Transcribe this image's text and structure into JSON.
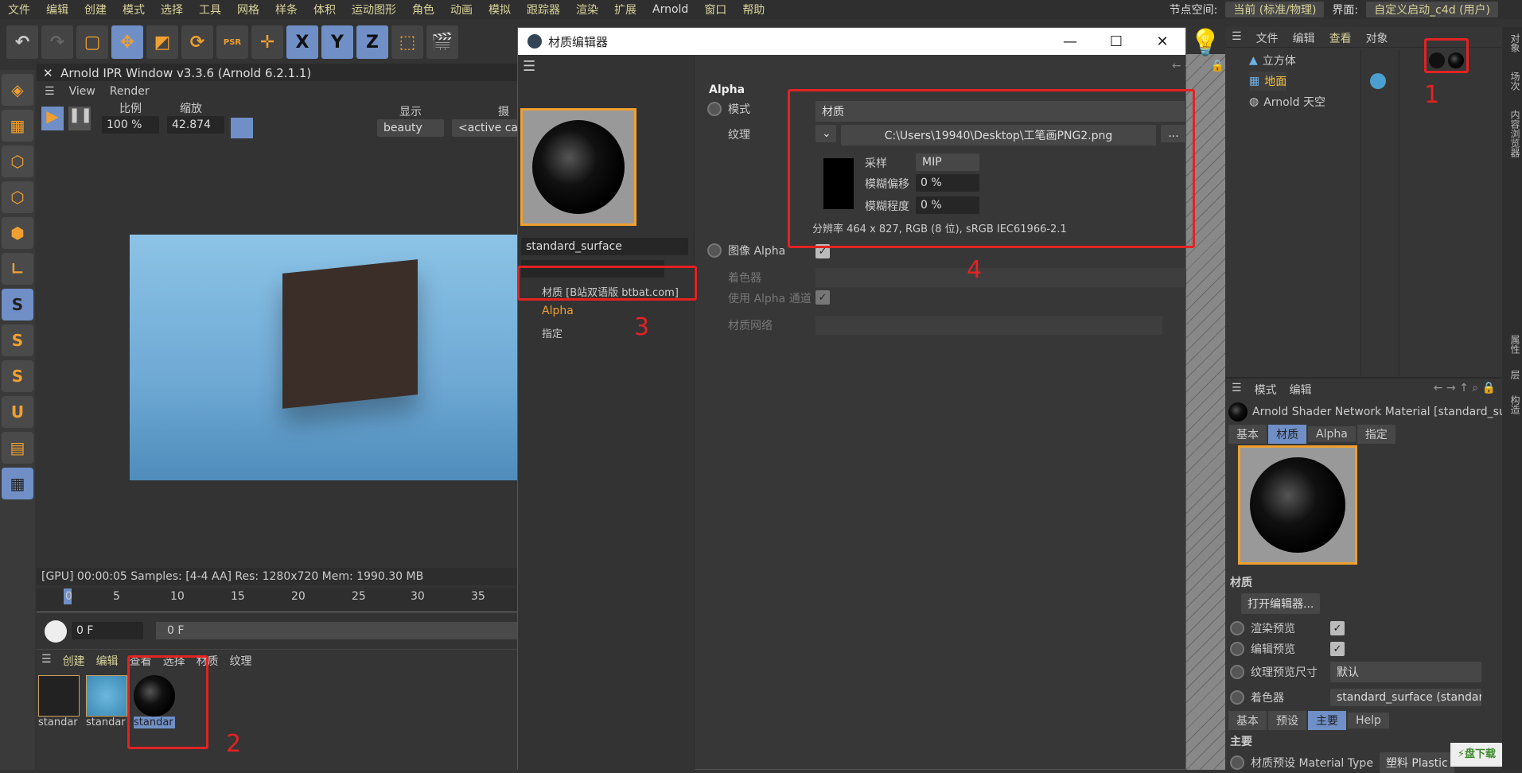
{
  "menu": [
    "文件",
    "编辑",
    "创建",
    "模式",
    "选择",
    "工具",
    "网格",
    "样条",
    "体积",
    "运动图形",
    "角色",
    "动画",
    "模拟",
    "跟踪器",
    "渲染",
    "扩展",
    "Arnold",
    "窗口",
    "帮助"
  ],
  "node_space": {
    "label": "节点空间:",
    "value": "当前 (标准/物理)"
  },
  "layout": {
    "label": "界面:",
    "value": "自定义启动_c4d (用户)"
  },
  "toolbar": {
    "x": "X",
    "y": "Y",
    "z": "Z",
    "psr": "PSR"
  },
  "ipr": {
    "title": "Arnold IPR Window v3.3.6 (Arnold 6.2.1.1)",
    "menu": [
      "View",
      "Render"
    ],
    "ratio_label": "比例",
    "ratio": "100 %",
    "zoom_label": "缩放",
    "zoom": "42.874",
    "display_label": "显示",
    "display": "beauty",
    "camera_label": "摄像",
    "camera": "<active car",
    "status": "[GPU] 00:00:05  Samples: [4-4 AA]  Res: 1280x720  Mem: 1990.30 MB",
    "ticks": [
      "0",
      "5",
      "10",
      "15",
      "20",
      "25",
      "30",
      "35"
    ],
    "frame": "0 F",
    "frame_end": "0 F"
  },
  "mat_manager": {
    "menu": [
      "创建",
      "编辑",
      "查看",
      "选择",
      "材质",
      "纹理"
    ],
    "items": [
      "standar",
      "standar",
      "standar"
    ]
  },
  "editor": {
    "title": "材质编辑器",
    "name": "standard_surface",
    "channels": [
      "材质 [B站双语版 btbat.com]",
      "Alpha",
      "指定"
    ],
    "section": "Alpha",
    "mode_label": "模式",
    "mode": "材质",
    "texture_label": "纹理",
    "texture_path": "C:\\Users\\19940\\Desktop\\工笔画PNG2.png",
    "browse": "...",
    "sampling_label": "采样",
    "sampling": "MIP",
    "blur_offset_label": "模糊偏移",
    "blur_offset": "0 %",
    "blur_scale_label": "模糊程度",
    "blur_scale": "0 %",
    "resolution": "分辨率 464 x 827, RGB (8 位), sRGB IEC61966-2.1",
    "image_alpha": "图像 Alpha",
    "shader_label": "着色器",
    "use_alpha": "使用 Alpha 通道",
    "network_label": "材质网络"
  },
  "objects": {
    "menu": [
      "文件",
      "编辑",
      "查看",
      "对象"
    ],
    "items": [
      "立方体",
      "地面",
      "Arnold 天空"
    ]
  },
  "attr": {
    "menu": [
      "模式",
      "编辑"
    ],
    "title": "Arnold Shader Network Material [standard_sur",
    "tabs": [
      "基本",
      "材质",
      "Alpha",
      "指定"
    ],
    "section": "材质",
    "open_editor": "打开编辑器...",
    "render_preview": "渲染预览",
    "editor_preview": "编辑预览",
    "tex_size_label": "纹理预览尺寸",
    "tex_size": "默认",
    "shader_label": "着色器",
    "shader": "standard_surface (standard_s",
    "tabs2": [
      "基本",
      "预设",
      "主要",
      "Help"
    ],
    "section2": "主要",
    "mat_type_label": "材质预设 Material Type",
    "mat_type": "塑料 Plastic"
  },
  "side_tabs": [
    "对象",
    "场次",
    "内容浏览器",
    "属性",
    "层",
    "构造"
  ],
  "annotations": [
    "1",
    "2",
    "3",
    "4"
  ],
  "watermark": "快盘下载",
  "colors": {
    "accent": "#6f8fc6",
    "highlight": "#f0a030",
    "annotation": "#e32222"
  }
}
